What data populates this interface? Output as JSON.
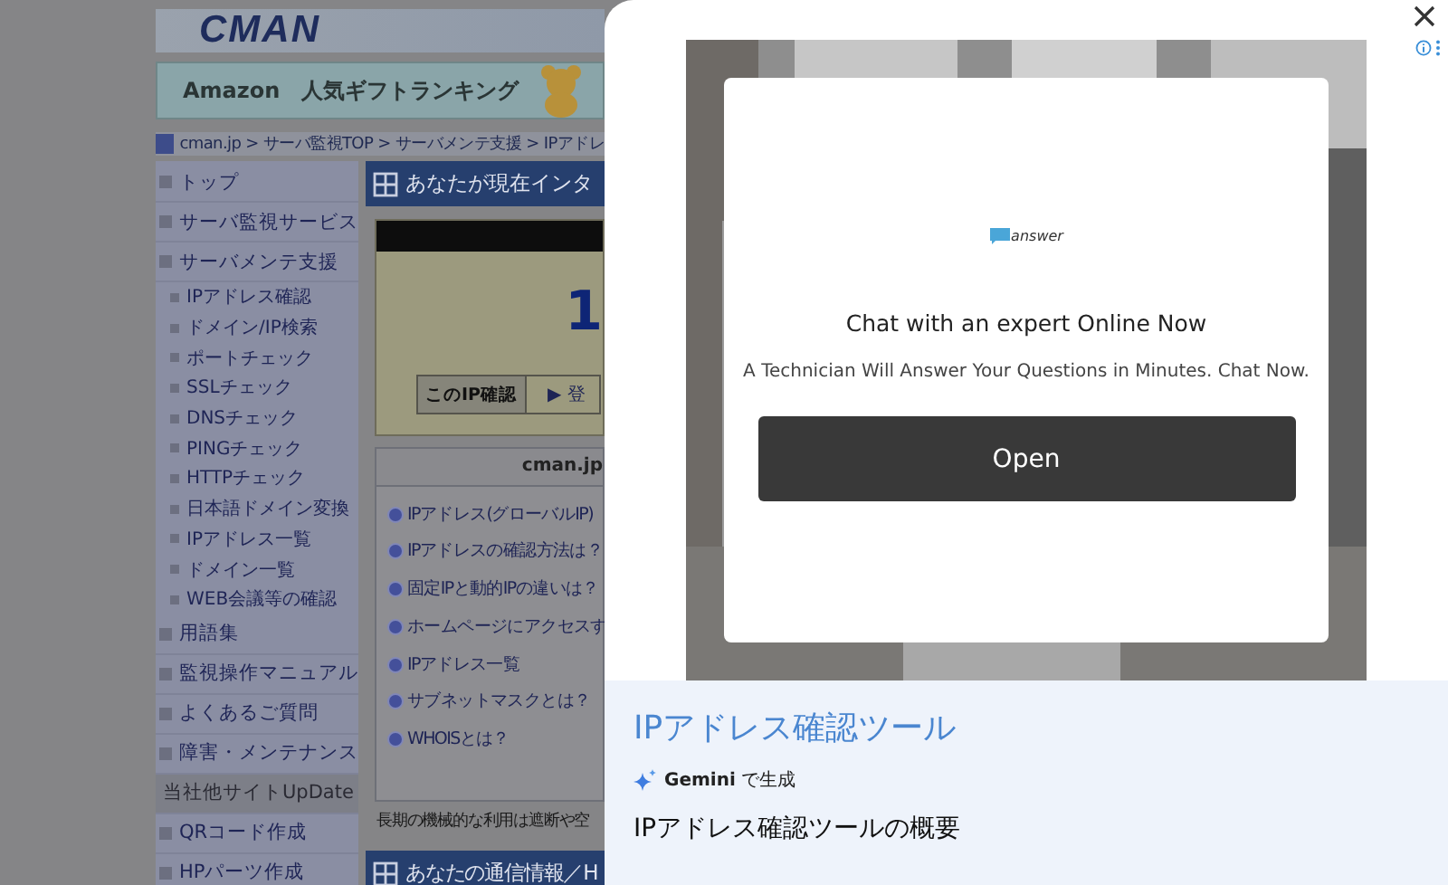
{
  "page": {
    "logo": "CMAN",
    "banner": "Amazon　人気ギフトランキング",
    "breadcrumb": "cman.jp > サーバ監視TOP > サーバメンテ支援 > IPアドレ",
    "sidebar": [
      {
        "kind": "section",
        "label": "トップ"
      },
      {
        "kind": "section",
        "label": "サーバ監視サービス"
      },
      {
        "kind": "section",
        "label": "サーバメンテ支援"
      },
      {
        "kind": "sub",
        "label": "IPアドレス確認"
      },
      {
        "kind": "sub",
        "label": "ドメイン/IP検索"
      },
      {
        "kind": "sub",
        "label": "ポートチェック"
      },
      {
        "kind": "sub",
        "label": "SSLチェック"
      },
      {
        "kind": "sub",
        "label": "DNSチェック"
      },
      {
        "kind": "sub",
        "label": "PINGチェック"
      },
      {
        "kind": "sub",
        "label": "HTTPチェック"
      },
      {
        "kind": "sub",
        "label": "日本語ドメイン変換"
      },
      {
        "kind": "sub",
        "label": "IPアドレス一覧"
      },
      {
        "kind": "sub",
        "label": "ドメイン一覧"
      },
      {
        "kind": "sub",
        "label": "WEB会議等の確認"
      },
      {
        "kind": "section",
        "label": "用語集"
      },
      {
        "kind": "section",
        "label": "監視操作マニュアル"
      },
      {
        "kind": "section",
        "label": "よくあるご質問"
      },
      {
        "kind": "section",
        "label": "障害・メンテナンス"
      },
      {
        "kind": "heading",
        "label": "当社他サイトUpDate"
      },
      {
        "kind": "section",
        "label": "QRコード作成"
      },
      {
        "kind": "section",
        "label": "HPパーツ作成"
      }
    ],
    "main": {
      "heading": "あなたが現在インタ",
      "ip_digit": "1",
      "ip_button": "このIP確認",
      "register_link": "▶ 登",
      "links_header": "cman.jp",
      "links": [
        "IPアドレス(グローバルIP)",
        "IPアドレスの確認方法は？",
        "固定IPと動的IPの違いは？",
        "ホームページにアクセスす",
        "IPアドレス一覧",
        "サブネットマスクとは？",
        "WHOISとは？"
      ],
      "notice": "長期の機械的な利用は遮断や空",
      "heading_2": "あなたの通信情報／H"
    }
  },
  "ad": {
    "brand": "answer",
    "headline": "Chat with an expert Online Now",
    "text": "A Technician Will Answer Your Questions in Minutes. Chat Now.",
    "button": "Open"
  },
  "panel": {
    "title": "IPアドレス確認ツール",
    "generated_by": "**Gemini** で生成",
    "subtitle": "IPアドレス確認ツールの概要"
  }
}
